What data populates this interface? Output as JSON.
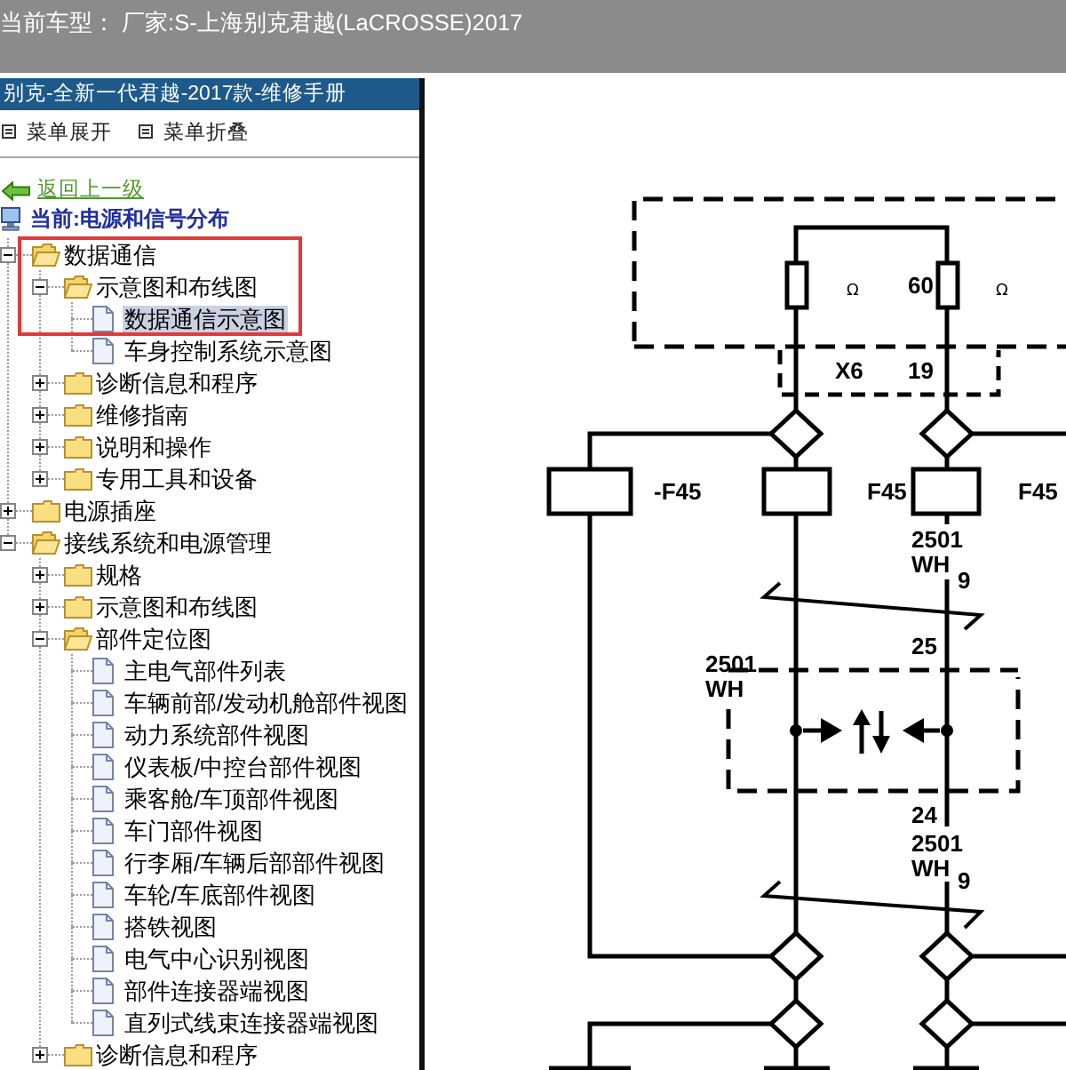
{
  "header": {
    "vehicle": "当前车型： 厂家:S-上海别克君越(LaCROSSE)2017"
  },
  "sidebar": {
    "title": "别克-全新一代君越-2017款-维修手册",
    "toolbar": [
      {
        "label": "菜单展开"
      },
      {
        "label": "菜单折叠"
      }
    ],
    "back_link": "返回上一级",
    "current": "当前:电源和信号分布",
    "tree": [
      {
        "label": "数据通信",
        "kind": "folder",
        "expanded": true,
        "selected": false,
        "children": [
          {
            "label": "示意图和布线图",
            "kind": "folder",
            "expanded": true,
            "selected": false,
            "children": [
              {
                "label": "数据通信示意图",
                "kind": "page",
                "selected": true
              },
              {
                "label": "车身控制系统示意图",
                "kind": "page",
                "selected": false
              }
            ]
          },
          {
            "label": "诊断信息和程序",
            "kind": "folder",
            "expanded": false,
            "selected": false
          },
          {
            "label": "维修指南",
            "kind": "folder",
            "expanded": false,
            "selected": false
          },
          {
            "label": "说明和操作",
            "kind": "folder",
            "expanded": false,
            "selected": false
          },
          {
            "label": "专用工具和设备",
            "kind": "folder",
            "expanded": false,
            "selected": false
          }
        ]
      },
      {
        "label": "电源插座",
        "kind": "folder",
        "expanded": false,
        "selected": false
      },
      {
        "label": "接线系统和电源管理",
        "kind": "folder",
        "expanded": true,
        "selected": false,
        "children": [
          {
            "label": "规格",
            "kind": "folder",
            "expanded": false,
            "selected": false
          },
          {
            "label": "示意图和布线图",
            "kind": "folder",
            "expanded": false,
            "selected": false
          },
          {
            "label": "部件定位图",
            "kind": "folder",
            "expanded": true,
            "selected": false,
            "children": [
              {
                "label": "主电气部件列表",
                "kind": "page",
                "selected": false
              },
              {
                "label": "车辆前部/发动机舱部件视图",
                "kind": "page",
                "selected": false
              },
              {
                "label": "动力系统部件视图",
                "kind": "page",
                "selected": false
              },
              {
                "label": "仪表板/中控台部件视图",
                "kind": "page",
                "selected": false
              },
              {
                "label": "乘客舱/车顶部件视图",
                "kind": "page",
                "selected": false
              },
              {
                "label": "车门部件视图",
                "kind": "page",
                "selected": false
              },
              {
                "label": "行李厢/车辆后部部件视图",
                "kind": "page",
                "selected": false
              },
              {
                "label": "车轮/车底部件视图",
                "kind": "page",
                "selected": false
              },
              {
                "label": "搭铁视图",
                "kind": "page",
                "selected": false
              },
              {
                "label": "电气中心识别视图",
                "kind": "page",
                "selected": false
              },
              {
                "label": "部件连接器端视图",
                "kind": "page",
                "selected": false
              },
              {
                "label": "直列式线束连接器端视图",
                "kind": "page",
                "selected": false
              }
            ]
          },
          {
            "label": "诊断信息和程序",
            "kind": "folder",
            "expanded": false,
            "selected": false
          }
        ]
      }
    ]
  },
  "diagram": {
    "terminator": {
      "units": [
        "Ω",
        "Ω"
      ],
      "resistance": "60"
    },
    "connector": {
      "name": "X6",
      "pin": "19"
    },
    "devices": [
      "-F45",
      "F45",
      "F45"
    ],
    "upper_wire": {
      "circuit": "2501",
      "code": "WH",
      "pin": "9"
    },
    "upper_pin": "25",
    "left_wire": {
      "circuit": "2501",
      "code": "WH"
    },
    "lower_pin": "24",
    "lower_wire": {
      "circuit": "2501",
      "code": "WH",
      "pin": "9"
    }
  }
}
